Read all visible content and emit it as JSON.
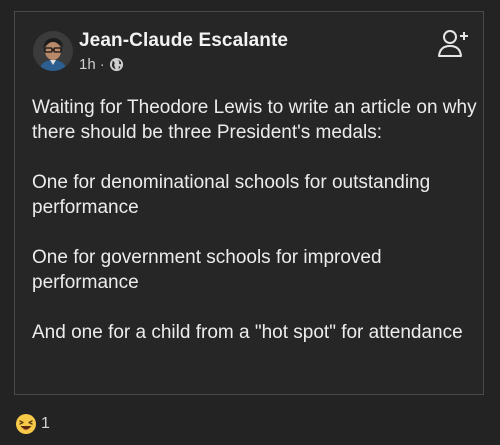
{
  "post": {
    "author_name": "Jean-Claude Escalante",
    "time": "1h",
    "separator": "·",
    "privacy_icon": "globe-icon",
    "action_icon": "add-friend-icon",
    "paragraphs": [
      "Waiting for Theodore Lewis to write an article on why there should be three President's medals:",
      "One for denominational schools for outstanding performance",
      "One for government schools for improved performance",
      "And one for a child from a \"hot spot\" for attendance"
    ]
  },
  "reactions": {
    "emoji_icon": "laughing-emoji-icon",
    "count": "1"
  },
  "colors": {
    "background": "#232323",
    "card_border": "#4a4a4a",
    "text": "#ececec",
    "emoji_yellow": "#f7c948"
  }
}
